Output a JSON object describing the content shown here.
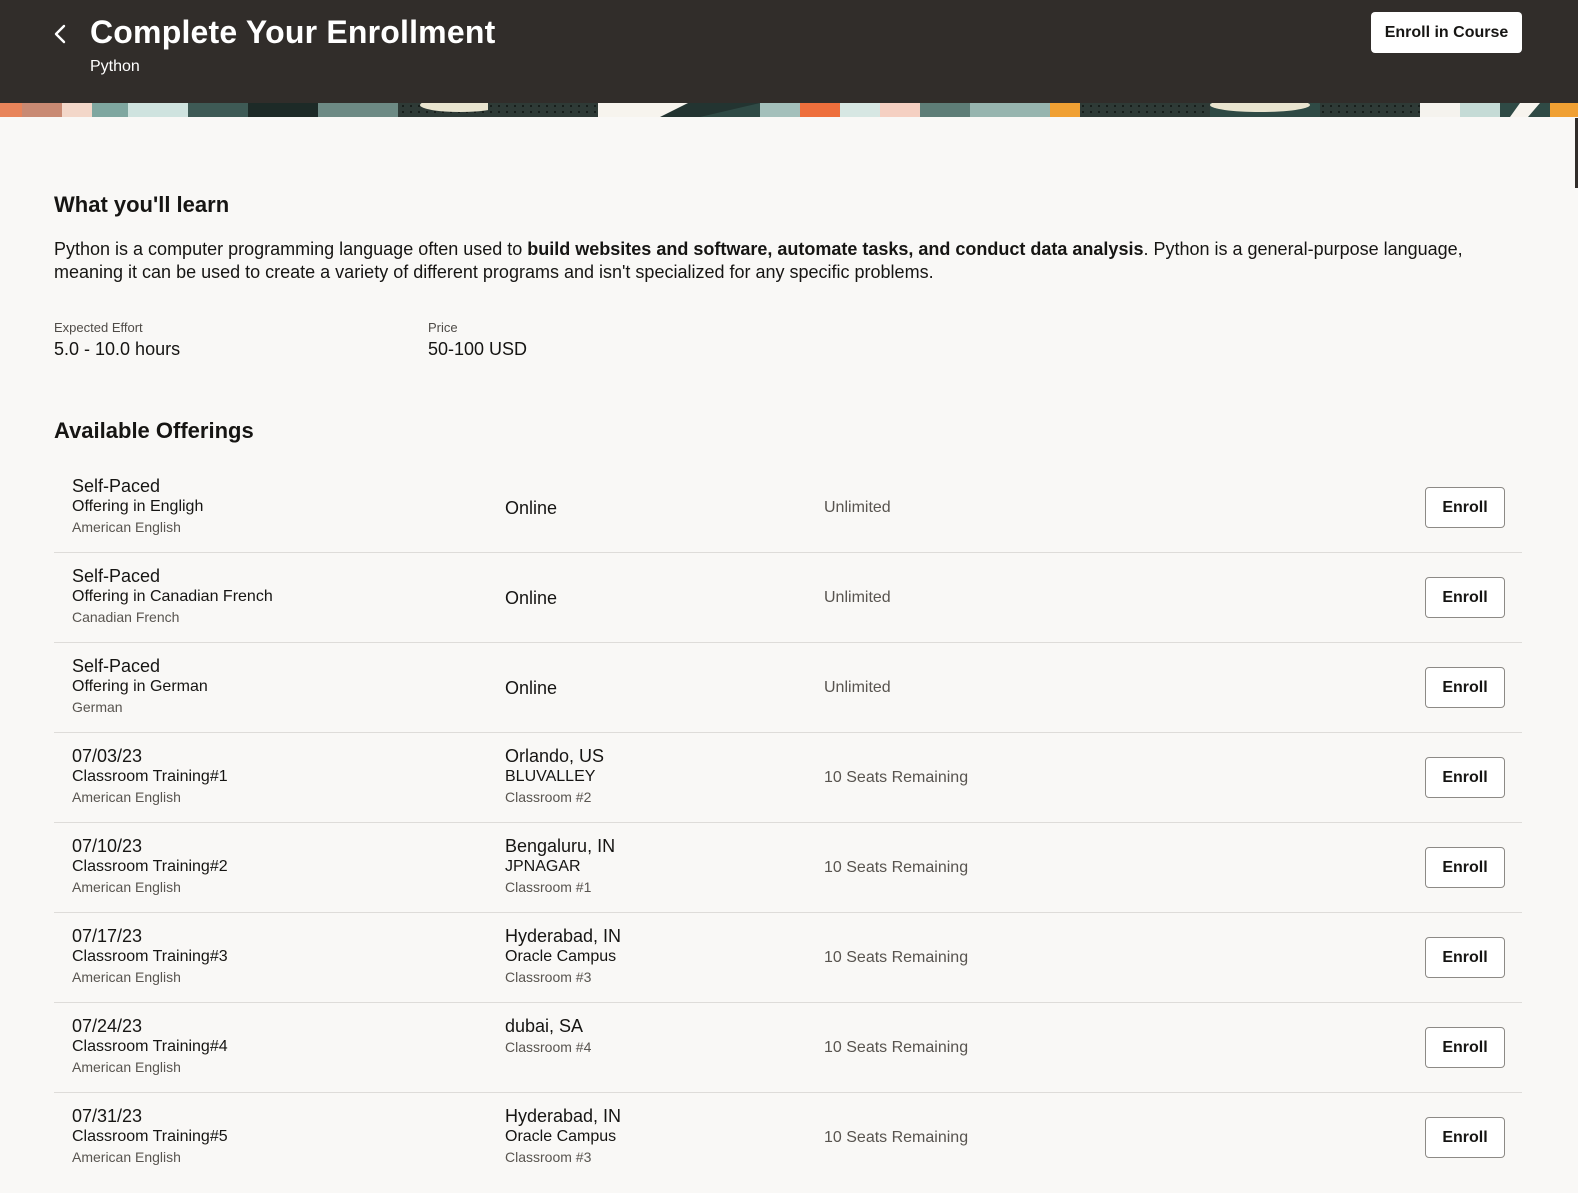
{
  "header": {
    "title": "Complete Your Enrollment",
    "subtitle": "Python",
    "enroll_course_label": "Enroll in Course",
    "bg_color": "#312d2a"
  },
  "learn": {
    "heading": "What you'll learn",
    "desc_pre": "Python is a computer programming language often used to ",
    "desc_bold": "build websites and software, automate tasks, and conduct data analysis",
    "desc_post": ". Python is a general-purpose language, meaning it can be used to create a variety of different programs and isn't specialized for any specific problems."
  },
  "meta": {
    "effort_label": "Expected Effort",
    "effort_value": "5.0 - 10.0 hours",
    "price_label": "Price",
    "price_value": "50-100 USD"
  },
  "offerings": {
    "heading": "Available Offerings",
    "enroll_label": "Enroll",
    "rows": [
      {
        "line1": "Self-Paced",
        "line2": "Offering in Engligh",
        "line3": "American English",
        "loc1": "Online",
        "loc2": "",
        "loc3": "",
        "seats": "Unlimited"
      },
      {
        "line1": "Self-Paced",
        "line2": "Offering in Canadian French",
        "line3": "Canadian French",
        "loc1": "Online",
        "loc2": "",
        "loc3": "",
        "seats": "Unlimited"
      },
      {
        "line1": "Self-Paced",
        "line2": "Offering in German",
        "line3": "German",
        "loc1": "Online",
        "loc2": "",
        "loc3": "",
        "seats": "Unlimited"
      },
      {
        "line1": "07/03/23",
        "line2": "Classroom Training#1",
        "line3": "American English",
        "loc1": "Orlando, US",
        "loc2": "BLUVALLEY",
        "loc3": "Classroom #2",
        "seats": "10 Seats Remaining"
      },
      {
        "line1": "07/10/23",
        "line2": "Classroom Training#2",
        "line3": "American English",
        "loc1": "Bengaluru, IN",
        "loc2": "JPNAGAR",
        "loc3": "Classroom #1",
        "seats": "10 Seats Remaining"
      },
      {
        "line1": "07/17/23",
        "line2": "Classroom Training#3",
        "line3": "American English",
        "loc1": "Hyderabad, IN",
        "loc2": "Oracle Campus",
        "loc3": "Classroom #3",
        "seats": "10 Seats Remaining"
      },
      {
        "line1": "07/24/23",
        "line2": "Classroom Training#4",
        "line3": "American English",
        "loc1": "dubai, SA",
        "loc2": "",
        "loc3": "Classroom #4",
        "seats": "10 Seats Remaining"
      },
      {
        "line1": "07/31/23",
        "line2": "Classroom Training#5",
        "line3": "American English",
        "loc1": "Hyderabad, IN",
        "loc2": "Oracle Campus",
        "loc3": "Classroom #3",
        "seats": "10 Seats Remaining"
      }
    ]
  }
}
